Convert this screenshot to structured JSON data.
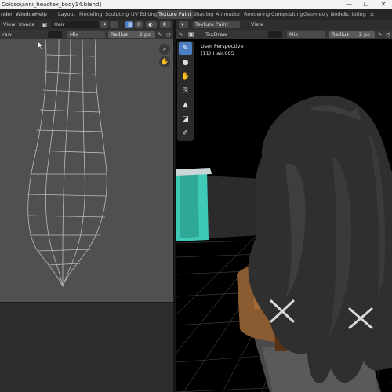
{
  "window": {
    "title": "Coloso\\anni_headtex_body14.blend]",
    "minimize": "—",
    "maximize": "☐",
    "close": "✕"
  },
  "menubar": {
    "items": [
      "nder",
      "Window",
      "Help"
    ],
    "workspaces": [
      "Layout",
      "Modeling",
      "Sculpting",
      "UV Editing",
      "Texture Paint",
      "Shading",
      "Animation",
      "Rendering",
      "Compositing",
      "Geometry Nodes",
      "Scripting"
    ],
    "active_workspace": "Texture Paint"
  },
  "uv_editor": {
    "view": "View",
    "image": "Image",
    "image_name": "Hair",
    "brush": "raw",
    "blend": "Mix",
    "radius_label": "Radius",
    "radius_value": "2 px"
  },
  "viewport": {
    "brush": "TexDraw",
    "blend": "Mix",
    "radius_label": "Radius",
    "radius_value": "2 px",
    "mode": "Texture Paint",
    "view": "View",
    "perspective": "User Perspective",
    "object": "(11) Hair.005"
  },
  "colors": {
    "accent": "#4d7fc4",
    "uv_background": "#505050",
    "viewport_background": "#000000",
    "grid": "#3a3a3a",
    "teal": "#3fc9b7"
  }
}
